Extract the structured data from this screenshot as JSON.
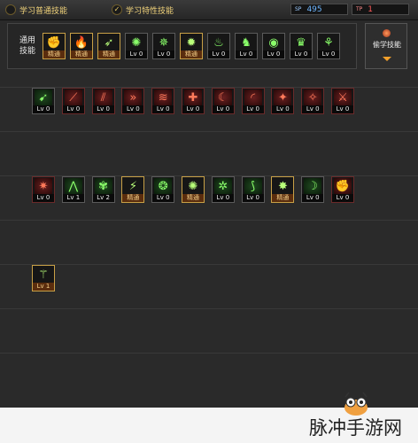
{
  "tabs": {
    "normal": {
      "label": "学习普通技能",
      "selected": false
    },
    "special": {
      "label": "学习特性技能",
      "selected": true
    }
  },
  "counters": {
    "blue": {
      "icon": "SP",
      "value": "495",
      "color": "#6fb7ff"
    },
    "red": {
      "icon": "TP",
      "value": "1",
      "color": "#ff5a5a"
    }
  },
  "top_panel": {
    "label": "通用技能",
    "skills": [
      {
        "icon": "warrior-icon",
        "glyph": "✊",
        "level": "精通",
        "style": "gold"
      },
      {
        "icon": "flame-warrior-icon",
        "glyph": "🔥",
        "level": "精通",
        "style": "gold"
      },
      {
        "icon": "leap-icon",
        "glyph": "➶",
        "level": "精通",
        "style": "gold"
      },
      {
        "icon": "wings-icon",
        "glyph": "✺",
        "level": "Lv 0",
        "style": "dark"
      },
      {
        "icon": "compass-icon",
        "glyph": "✵",
        "level": "Lv 0",
        "style": "dark"
      },
      {
        "icon": "star-burst-icon",
        "glyph": "✹",
        "level": "精通",
        "style": "gold"
      },
      {
        "icon": "rune-icon",
        "glyph": "♨",
        "level": "Lv 0",
        "style": "dark"
      },
      {
        "icon": "figure-icon",
        "glyph": "♞",
        "level": "Lv 0",
        "style": "dark"
      },
      {
        "icon": "eye-icon",
        "glyph": "◉",
        "level": "Lv 0",
        "style": "dark"
      },
      {
        "icon": "golden-man-icon",
        "glyph": "♛",
        "level": "Lv 0",
        "style": "dark"
      },
      {
        "icon": "green-rune-icon",
        "glyph": "⚘",
        "level": "Lv 0",
        "style": "dark"
      }
    ]
  },
  "side_button": {
    "label": "偷学技能"
  },
  "rows": [
    {
      "skills": [
        {
          "icon": "sprint-icon",
          "glyph": "➹",
          "level": "Lv 0",
          "style": "green"
        },
        {
          "icon": "slash-red-icon",
          "glyph": "⟋",
          "level": "Lv 0",
          "style": "red"
        },
        {
          "icon": "claw-red-icon",
          "glyph": "⫽",
          "level": "Lv 0",
          "style": "red"
        },
        {
          "icon": "dash-red-icon",
          "glyph": "»",
          "level": "Lv 0",
          "style": "red"
        },
        {
          "icon": "wave-red-icon",
          "glyph": "≋",
          "level": "Lv 0",
          "style": "red"
        },
        {
          "icon": "cross-shield-icon",
          "glyph": "✚",
          "level": "Lv 0",
          "style": "red"
        },
        {
          "icon": "crescent-red-icon",
          "glyph": "☾",
          "level": "Lv 0",
          "style": "red"
        },
        {
          "icon": "arc-red-icon",
          "glyph": "◜",
          "level": "Lv 0",
          "style": "red"
        },
        {
          "icon": "kick-red-icon",
          "glyph": "✦",
          "level": "Lv 0",
          "style": "red"
        },
        {
          "icon": "spin-red-icon",
          "glyph": "✧",
          "level": "Lv 0",
          "style": "red"
        },
        {
          "icon": "strike-red-icon",
          "glyph": "⚔",
          "level": "Lv 0",
          "style": "red"
        }
      ]
    },
    {
      "skills": [
        {
          "icon": "spark-red-icon",
          "glyph": "✷",
          "level": "Lv 0",
          "style": "red"
        },
        {
          "icon": "vine-icon",
          "glyph": "⋀",
          "level": "Lv 1",
          "style": "green"
        },
        {
          "icon": "spiral-icon",
          "glyph": "✾",
          "level": "Lv 2",
          "style": "green"
        },
        {
          "icon": "green-flash-icon",
          "glyph": "⚡",
          "level": "精通",
          "style": "gold"
        },
        {
          "icon": "swirl-icon",
          "glyph": "❂",
          "level": "Lv 0",
          "style": "green"
        },
        {
          "icon": "burst-icon",
          "glyph": "✺",
          "level": "精通",
          "style": "gold"
        },
        {
          "icon": "vortex-icon",
          "glyph": "✲",
          "level": "Lv 0",
          "style": "green"
        },
        {
          "icon": "blade-icon",
          "glyph": "⟆",
          "level": "Lv 0",
          "style": "green"
        },
        {
          "icon": "nova-icon",
          "glyph": "✸",
          "level": "精通",
          "style": "gold"
        },
        {
          "icon": "crescent-green-icon",
          "glyph": "☽",
          "level": "Lv 0",
          "style": "green"
        },
        {
          "icon": "fist-red-icon",
          "glyph": "✊",
          "level": "Lv 0",
          "style": "red"
        }
      ]
    },
    {
      "skills": [
        {
          "icon": "stance-icon",
          "glyph": "⚚",
          "level": "Lv 1",
          "style": "gold"
        }
      ]
    }
  ],
  "watermark": {
    "text": "脉冲手游网"
  }
}
